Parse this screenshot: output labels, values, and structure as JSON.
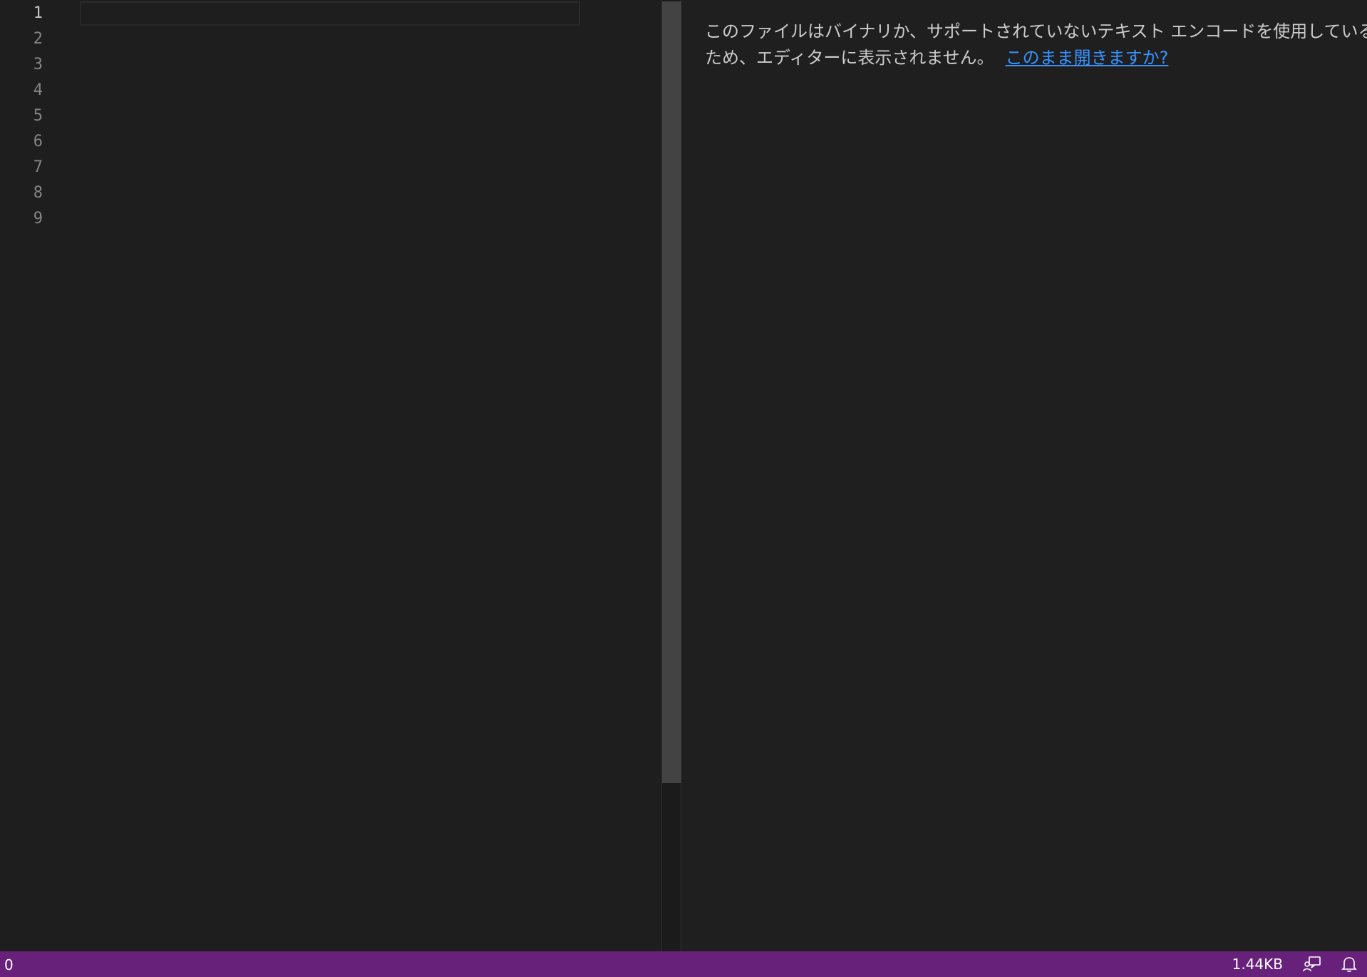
{
  "editor": {
    "line_numbers": [
      "1",
      "2",
      "3",
      "4",
      "5",
      "6",
      "7",
      "8",
      "9"
    ],
    "active_line": "1"
  },
  "binary_editor": {
    "message": "このファイルはバイナリか、サポートされていないテキスト エンコードを使用しているため、エディターに表示されません。",
    "open_anyway_link": "このまま開きますか?"
  },
  "status_bar": {
    "left_item": "0",
    "file_size": "1.44KB",
    "icons": [
      "feedback-icon",
      "bell-icon"
    ],
    "background": "#68217a"
  },
  "colors": {
    "link": "#3794ff",
    "editor_background": "#1e1e1e",
    "status_bar": "#68217a"
  }
}
